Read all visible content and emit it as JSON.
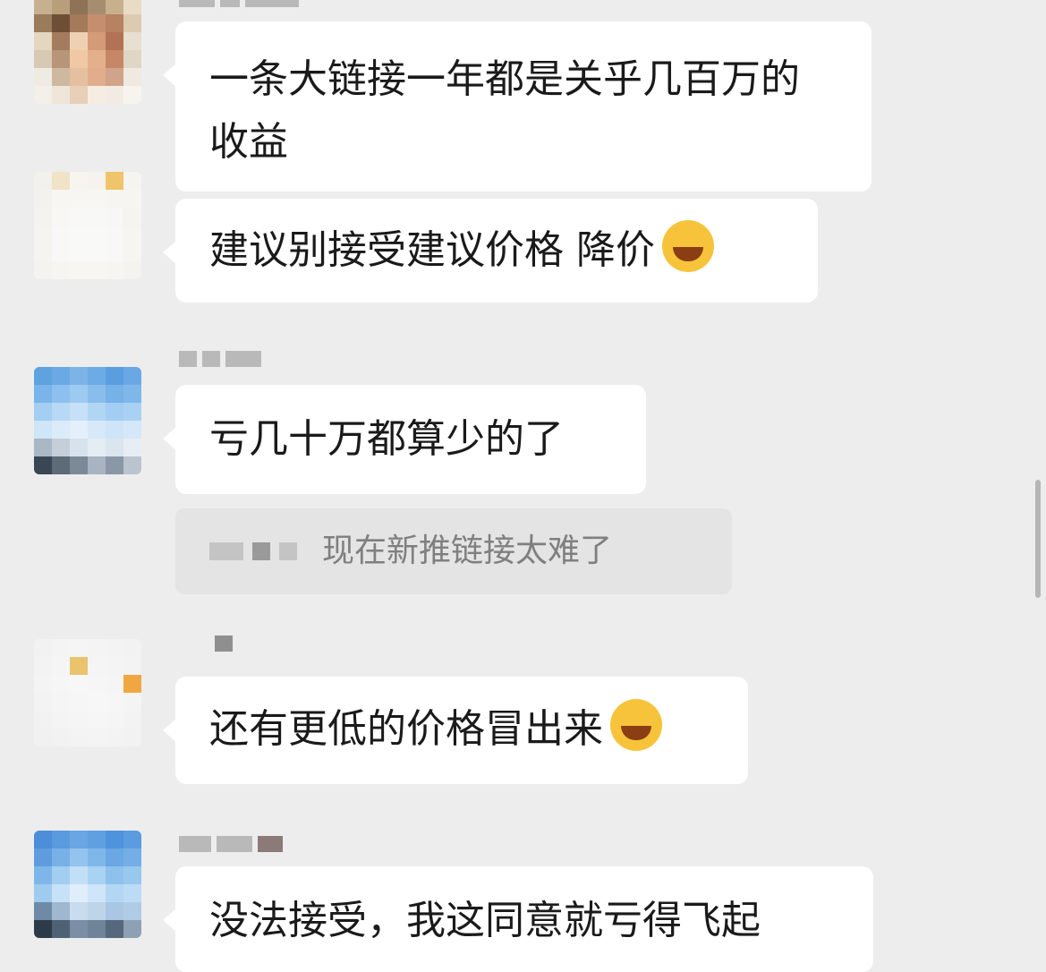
{
  "messages": [
    {
      "text": "一条大链接一年都是关乎几百万的收益",
      "avatar_colors": [
        "#c7b08f",
        "#b89f7b",
        "#8f7356",
        "#a78d6f",
        "#c8b08d",
        "#e8dcc6",
        "#9a7b5b",
        "#6d4f36",
        "#a47a5a",
        "#c58f6d",
        "#b78262",
        "#dccbb1",
        "#e4d6bf",
        "#a37c5e",
        "#f0d0b3",
        "#d49b78",
        "#b17354",
        "#e7dfd0",
        "#d8c9b4",
        "#b69579",
        "#f1c8a6",
        "#e4b08b",
        "#c58766",
        "#e0d6c5",
        "#f0ebe2",
        "#cfb8a0",
        "#e4c0a0",
        "#e1ad8c",
        "#cfa48a",
        "#efe9e0",
        "#f3f0ea",
        "#efe5d8",
        "#e8cfb8",
        "#f5ede2",
        "#f2ebe3",
        "#f7f4ef"
      ]
    },
    {
      "text": "建议别接受建议价格 降价",
      "emoji": "face-with-tears-of-joy",
      "avatar_colors": [
        "#f3f1ec",
        "#f0e3c6",
        "#f7f5f0",
        "#f6f3ee",
        "#f0c46a",
        "#f6f4f0",
        "#f4f2ee",
        "#f7f6f3",
        "#f7f6f3",
        "#f7f6f3",
        "#f6f5f2",
        "#f6f5f2",
        "#f4f3f0",
        "#f8f7f4",
        "#f8f8f6",
        "#f8f8f6",
        "#f7f7f5",
        "#f5f4f1",
        "#f5f4f1",
        "#f8f8f6",
        "#f9f9f7",
        "#f9f9f7",
        "#f8f8f6",
        "#f6f5f2",
        "#f5f4f1",
        "#f8f8f6",
        "#f9f9f7",
        "#f9f9f7",
        "#f8f8f6",
        "#f6f5f2",
        "#f4f3f0",
        "#f6f5f2",
        "#f7f6f3",
        "#f7f6f3",
        "#f6f5f2",
        "#f4f3f0"
      ]
    },
    {
      "text": "亏几十万都算少的了",
      "sender_blocks": [
        20,
        20,
        40
      ],
      "avatar_colors": [
        "#5fa2e0",
        "#6aa9e4",
        "#7db4e8",
        "#6dabe6",
        "#5b9ee0",
        "#6aa8e5",
        "#7ab4ea",
        "#8dc0ee",
        "#9ccaf1",
        "#89bdec",
        "#76b1e8",
        "#80b7ea",
        "#a4cef2",
        "#b7d9f5",
        "#c5e0f7",
        "#b1d6f4",
        "#a3cdf2",
        "#a9d1f3",
        "#cfe5f8",
        "#dbebfa",
        "#e3f0fb",
        "#d7e9f9",
        "#cee4f8",
        "#d4e8f9",
        "#aab7c4",
        "#c4cfda",
        "#d8e2ec",
        "#e4ecf4",
        "#dbe5ee",
        "#e6edf4",
        "#3b4654",
        "#5d6a78",
        "#7c8997",
        "#a8b4c1",
        "#8a97a6",
        "#b9c4cf"
      ]
    },
    {
      "text": "还有更低的价格冒出来",
      "sender_blocks": [
        20
      ],
      "emoji": "face-with-tears-of-joy",
      "avatar_colors": [
        "#f2f2f2",
        "#f4f4f4",
        "#f5f5f5",
        "#f4f4f4",
        "#f3f3f3",
        "#f2f2f2",
        "#f3f3f3",
        "#f5f5f5",
        "#e9c46c",
        "#f5f5f5",
        "#f4f4f4",
        "#f3f3f3",
        "#f4f4f4",
        "#f6f6f6",
        "#f7f7f7",
        "#f6f6f6",
        "#f5f5f5",
        "#f0a742",
        "#f3f3f3",
        "#f5f5f5",
        "#f6f6f6",
        "#f7f7f7",
        "#f6f6f6",
        "#f4f4f4",
        "#f2f2f2",
        "#f4f4f4",
        "#f5f5f5",
        "#f6f6f6",
        "#f5f5f5",
        "#f3f3f3",
        "#f1f1f1",
        "#f2f2f2",
        "#f3f3f3",
        "#f4f4f4",
        "#f3f3f3",
        "#f2f2f2"
      ]
    },
    {
      "text": "没法接受，我这同意就亏得飞起",
      "sender_blocks": [
        36,
        40,
        28
      ],
      "avatar_colors": [
        "#4c8fd8",
        "#5a9ade",
        "#6aa6e3",
        "#5fa0e2",
        "#4e93dc",
        "#5b9be0",
        "#5e9cdd",
        "#78b1e6",
        "#94c3ee",
        "#80b7ea",
        "#6aa7e3",
        "#73aee6",
        "#7fb6e9",
        "#a3ceef",
        "#c1e0f7",
        "#a9d3f3",
        "#8ec1ec",
        "#98c8ee",
        "#9fcbef",
        "#c6e2f7",
        "#e0eefb",
        "#cfe5f8",
        "#b3d6f4",
        "#bcdbf5",
        "#6f8aa6",
        "#9fb8d0",
        "#c9dcef",
        "#bed4e9",
        "#a9c6e2",
        "#b0cbe5",
        "#2d3a48",
        "#4f6174",
        "#7a8fa5",
        "#6f8399",
        "#56687c",
        "#8ea1b4"
      ]
    }
  ],
  "quote": {
    "text": "现在新推链接太难了"
  }
}
